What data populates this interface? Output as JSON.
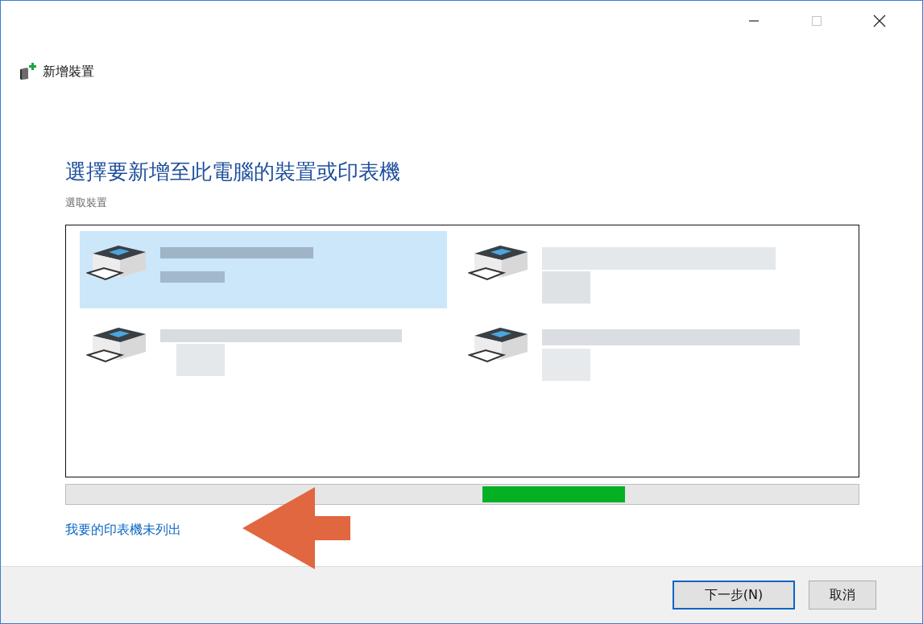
{
  "window": {
    "title": "新增裝置",
    "controls": [
      {
        "kind": "minimize",
        "disabled": false
      },
      {
        "kind": "maximize",
        "disabled": true
      },
      {
        "kind": "close",
        "disabled": false
      }
    ]
  },
  "heading": "選擇要新增至此電腦的裝置或印表機",
  "subheading": "選取裝置",
  "devices": [
    {
      "selected": true
    },
    {
      "selected": false
    },
    {
      "selected": false
    },
    {
      "selected": false
    }
  ],
  "link": "我要的印表機未列出",
  "buttons": [
    {
      "label": "下一步(N)",
      "default": true
    },
    {
      "label": "取消",
      "default": false
    }
  ]
}
